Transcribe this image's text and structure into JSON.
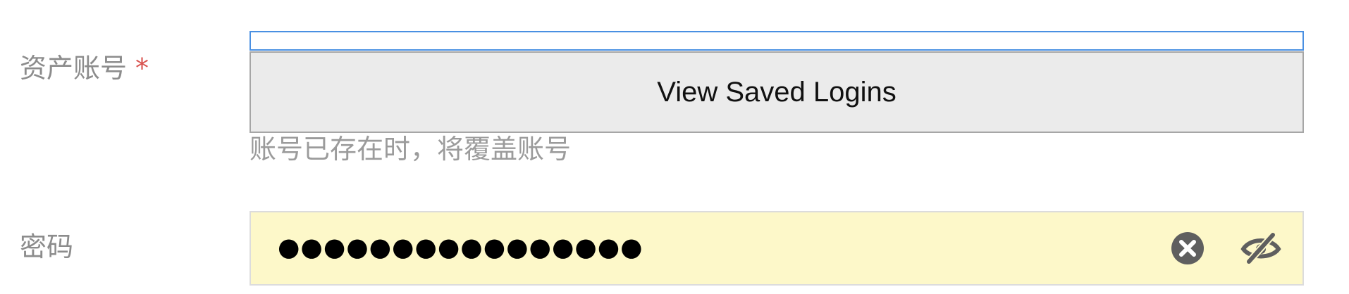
{
  "account_field": {
    "label": "资产账号",
    "required_mark": "*",
    "value": "",
    "helper_text": "账号已存在时，将覆盖账号"
  },
  "autofill_popup": {
    "label": "View Saved Logins"
  },
  "password_field": {
    "label": "密码",
    "masked_value": "●●●●●●●●●●●●●●●●",
    "clear_icon": "clear-circle-icon",
    "visibility_icon": "eye-slash-icon",
    "autofill_background": "#fdf8c9"
  },
  "colors": {
    "label": "#8c8c8c",
    "required": "#d9534f",
    "focus_border": "#4a90e2"
  }
}
